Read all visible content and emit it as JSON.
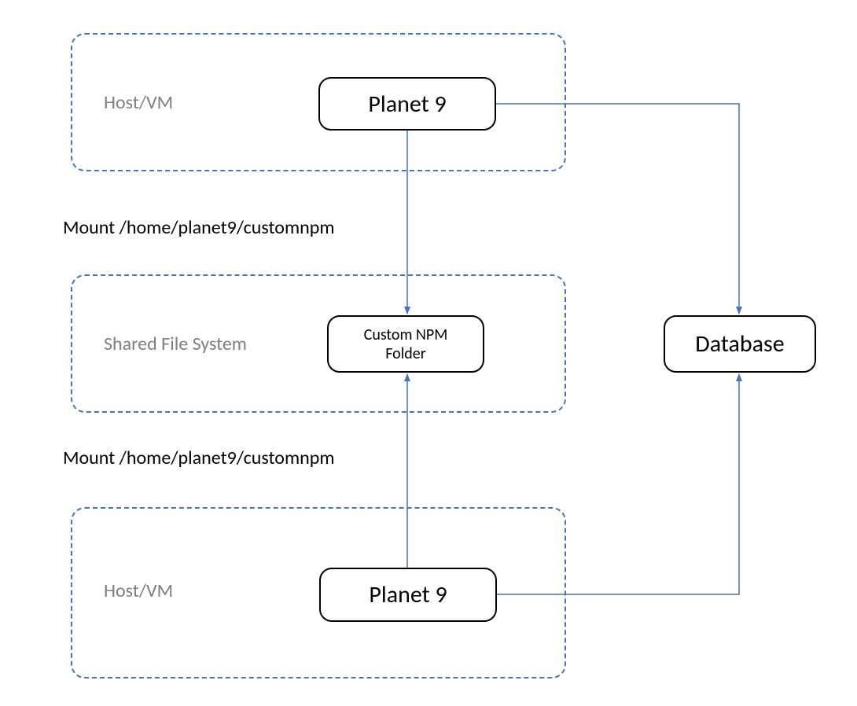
{
  "groups": {
    "host_vm_top": {
      "label": "Host/VM"
    },
    "shared_fs": {
      "label": "Shared File System"
    },
    "host_vm_bottom": {
      "label": "Host/VM"
    }
  },
  "nodes": {
    "planet9_top": {
      "label": "Planet 9"
    },
    "planet9_bottom": {
      "label": "Planet 9"
    },
    "custom_npm": {
      "label_line1": "Custom NPM",
      "label_line2": "Folder"
    },
    "database": {
      "label": "Database"
    }
  },
  "edge_labels": {
    "mount_top": "Mount /home/planet9/customnpm",
    "mount_bottom": "Mount /home/planet9/customnpm"
  },
  "colors": {
    "dashed_border": "#4472C4",
    "connector": "#4472C4",
    "group_label": "#7f7f7f"
  }
}
